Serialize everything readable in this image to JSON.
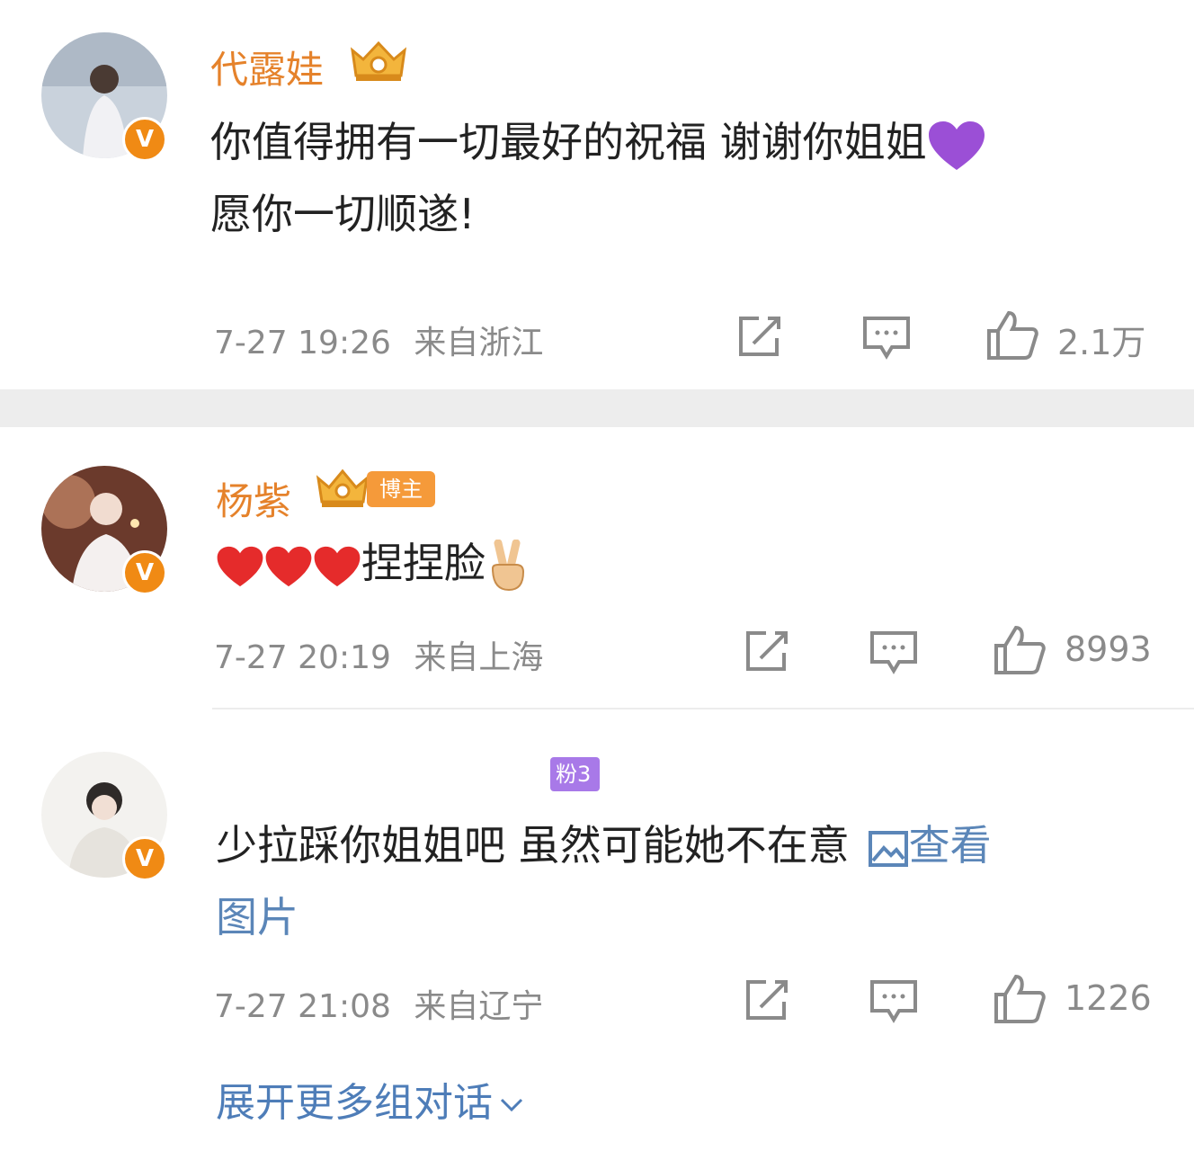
{
  "comments": [
    {
      "name": "代露娃",
      "text_line1": "你值得拥有一切最好的祝福 谢谢你姐姐",
      "text_line2": "愿你一切顺遂!",
      "time": "7-27 19:26",
      "location": "来自浙江",
      "likes": "2.1万"
    },
    {
      "name": "杨紫",
      "tag": "博主",
      "text": "捏捏脸",
      "time": "7-27 20:19",
      "location": "来自上海",
      "likes": "8993"
    },
    {
      "fan_tag": "粉3",
      "text_line1": "少拉踩你姐姐吧 虽然可能她不在意",
      "view_image_label": "查看",
      "text_line2": "图片",
      "time": "7-27 21:08",
      "location": "来自辽宁",
      "likes": "1226"
    }
  ],
  "more_label": "展开更多组对话",
  "colors": {
    "name": "#e5822b",
    "link": "#4e7db8",
    "meta": "#8a8a8a",
    "verified": "#f08a14"
  },
  "icons": [
    "repost-icon",
    "comment-icon",
    "like-icon",
    "chevron-down-icon",
    "image-icon",
    "heart-icon",
    "purple-heart-icon",
    "victory-hand-icon",
    "crown-icon"
  ]
}
